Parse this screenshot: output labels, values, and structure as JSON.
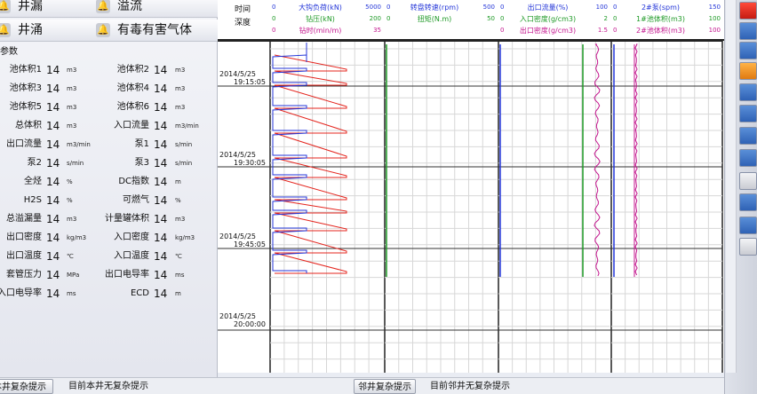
{
  "alarms": {
    "row1": [
      "井漏",
      "溢流"
    ],
    "row2": [
      "井涌",
      "有毒有害气体"
    ]
  },
  "params_title": "参数",
  "params": [
    [
      {
        "label": "池体积1",
        "value": "14",
        "unit": "m3"
      },
      {
        "label": "池体积2",
        "value": "14",
        "unit": "m3"
      }
    ],
    [
      {
        "label": "池体积3",
        "value": "14",
        "unit": "m3"
      },
      {
        "label": "池体积4",
        "value": "14",
        "unit": "m3"
      }
    ],
    [
      {
        "label": "池体积5",
        "value": "14",
        "unit": "m3"
      },
      {
        "label": "池体积6",
        "value": "14",
        "unit": "m3"
      }
    ],
    [
      {
        "label": "总体积",
        "value": "14",
        "unit": "m3"
      },
      {
        "label": "入口流量",
        "value": "14",
        "unit": "m3/min"
      }
    ],
    [
      {
        "label": "出口流量",
        "value": "14",
        "unit": "m3/min"
      },
      {
        "label": "泵1",
        "value": "14",
        "unit": "s/min"
      }
    ],
    [
      {
        "label": "泵2",
        "value": "14",
        "unit": "s/min"
      },
      {
        "label": "泵3",
        "value": "14",
        "unit": "s/min"
      }
    ],
    [
      {
        "label": "全烃",
        "value": "14",
        "unit": "%"
      },
      {
        "label": "DC指数",
        "value": "14",
        "unit": "m"
      }
    ],
    [
      {
        "label": "H2S",
        "value": "14",
        "unit": "%"
      },
      {
        "label": "可燃气",
        "value": "14",
        "unit": "%"
      }
    ],
    [
      {
        "label": "总溢漏量",
        "value": "14",
        "unit": "m3"
      },
      {
        "label": "计量罐体积",
        "value": "14",
        "unit": "m3"
      }
    ],
    [
      {
        "label": "出口密度",
        "value": "14",
        "unit": "kg/m3"
      },
      {
        "label": "入口密度",
        "value": "14",
        "unit": "kg/m3"
      }
    ],
    [
      {
        "label": "出口温度",
        "value": "14",
        "unit": "℃"
      },
      {
        "label": "入口温度",
        "value": "14",
        "unit": "℃"
      }
    ],
    [
      {
        "label": "套管压力",
        "value": "14",
        "unit": "MPa"
      },
      {
        "label": "出口电导率",
        "value": "14",
        "unit": "ms"
      }
    ],
    [
      {
        "label": "入口电导率",
        "value": "14",
        "unit": "ms"
      },
      {
        "label": "ECD",
        "value": "14",
        "unit": "m"
      }
    ]
  ],
  "chart_header": {
    "time_label": "时间",
    "depth_label": "深度",
    "tracks": [
      {
        "rows": [
          {
            "name": "大钩负荷(kN)",
            "min": "0",
            "max": "5000",
            "color": "#2436d8"
          },
          {
            "name": "钻压(kN)",
            "min": "0",
            "max": "200",
            "color": "#1f9a27"
          },
          {
            "name": "钻时(min/m)",
            "min": "0",
            "max": "35",
            "color": "#c4178f"
          }
        ]
      },
      {
        "rows": [
          {
            "name": "转盘转速(rpm)",
            "min": "0",
            "max": "500",
            "color": "#2436d8"
          },
          {
            "name": "扭矩(N.m)",
            "min": "0",
            "max": "50",
            "color": "#1f9a27"
          },
          {
            "name": "",
            "min": "",
            "max": "",
            "color": "#c4178f"
          }
        ]
      },
      {
        "rows": [
          {
            "name": "出口流量(%)",
            "min": "0",
            "max": "100",
            "color": "#2436d8"
          },
          {
            "name": "入口密度(g/cm3)",
            "min": "0",
            "max": "2",
            "color": "#1f9a27"
          },
          {
            "name": "出口密度(g/cm3)",
            "min": "0",
            "max": "1.5",
            "color": "#c4178f"
          }
        ]
      },
      {
        "rows": [
          {
            "name": "2#泵(spm)",
            "min": "0",
            "max": "150",
            "color": "#2436d8"
          },
          {
            "name": "1#池体积(m3)",
            "min": "0",
            "max": "100",
            "color": "#1f9a27"
          },
          {
            "name": "2#池体积(m3)",
            "min": "0",
            "max": "100",
            "color": "#c4178f"
          }
        ]
      }
    ]
  },
  "time_ticks": [
    {
      "date": "2014/5/25",
      "time": "19:15:05"
    },
    {
      "date": "2014/5/25",
      "time": "19:30:05"
    },
    {
      "date": "2014/5/25",
      "time": "19:45:05"
    },
    {
      "date": "2014/5/25",
      "time": "20:00:00"
    }
  ],
  "status": {
    "local_button": "本井复杂提示",
    "local_text": "目前本井无复杂提示",
    "nearby_button": "邻井复杂提示",
    "nearby_text": "目前邻井无复杂提示"
  }
}
